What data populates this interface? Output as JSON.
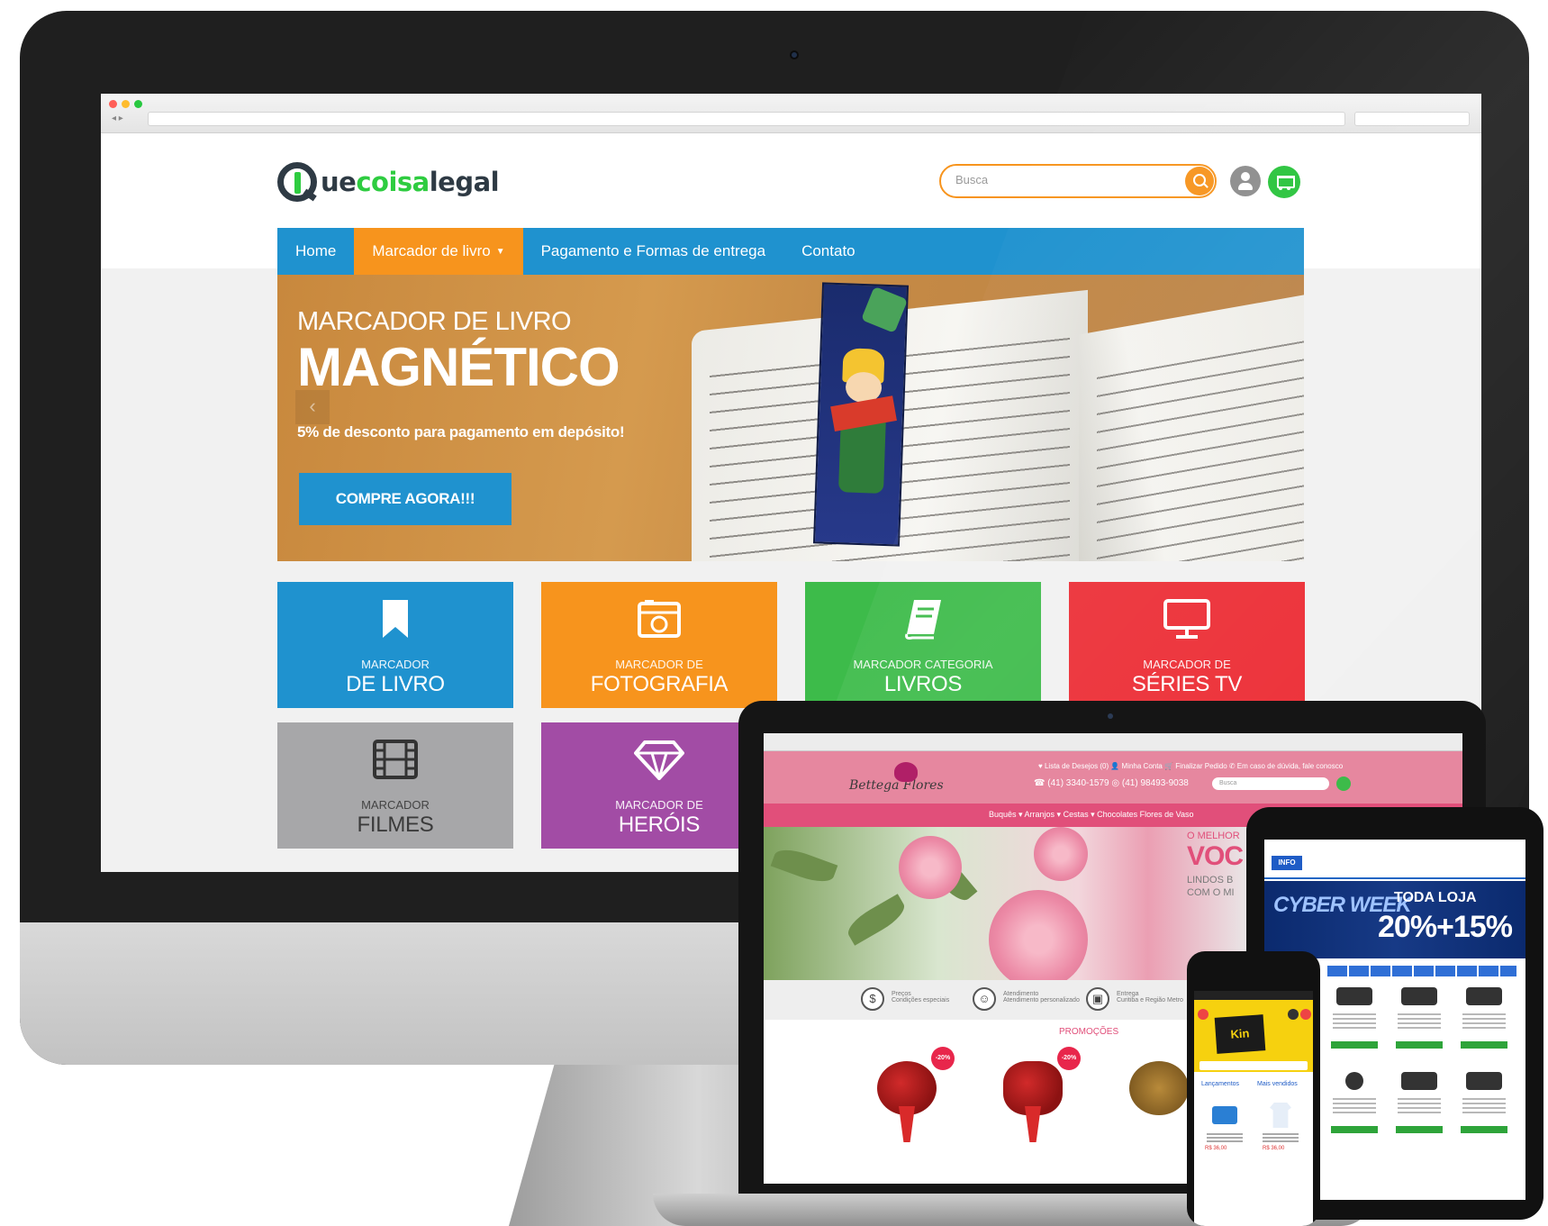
{
  "site": {
    "logo": {
      "prefix": "Q",
      "part1": "ue",
      "part2": "coisa",
      "part3": "legal"
    },
    "search": {
      "placeholder": "Busca"
    },
    "nav": {
      "items": [
        {
          "label": "Home"
        },
        {
          "label": "Marcador de livro",
          "dropdown": true
        },
        {
          "label": "Pagamento e Formas de entrega"
        },
        {
          "label": "Contato"
        }
      ],
      "active_index": 1
    },
    "hero": {
      "subtitle": "MARCADOR DE LIVRO",
      "title": "MAGNÉTICO",
      "description": "5% de desconto para pagamento em depósito!",
      "cta": "COMPRE AGORA!!!",
      "prev": "‹"
    },
    "categories": [
      {
        "small": "MARCADOR",
        "large": "DE LIVRO",
        "color": "#1f92cf",
        "icon": "bookmark-icon"
      },
      {
        "small": "MARCADOR DE",
        "large": "FOTOGRAFIA",
        "color": "#f7941d",
        "icon": "camera-icon"
      },
      {
        "small": "MARCADOR CATEGORIA",
        "large": "LIVROS",
        "color": "#3dbb4a",
        "icon": "book-icon"
      },
      {
        "small": "MARCADOR DE",
        "large": "SÉRIES TV",
        "color": "#ec2d35",
        "icon": "monitor-icon"
      },
      {
        "small": "MARCADOR",
        "large": "FILMES",
        "color": "#a7a7a9",
        "icon": "film-icon"
      },
      {
        "small": "MARCADOR DE",
        "large": "HERÓIS",
        "color": "#a24ca5",
        "icon": "diamond-icon"
      }
    ],
    "colors": {
      "primary": "#1f92cf",
      "accent": "#f7941d",
      "green": "#27c33a"
    }
  },
  "laptop": {
    "logo": "Bettega Flores",
    "top_links": "♥ Lista de Desejos (0)   👤 Minha Conta   🛒 Finalizar Pedido   ✆ Em caso de dúvida, fale conosco",
    "phones": "☎ (41) 3340-1579   ◎ (41) 98493-9038",
    "search_placeholder": "Busca",
    "nav": "Buquês ▾     Arranjos ▾     Cestas ▾     Chocolates     Flores de Vaso",
    "hero": {
      "kicker": "O MELHOR",
      "big": "VOC",
      "line1": "LINDOS B",
      "line2": "COM O MI"
    },
    "features": [
      {
        "icon": "$",
        "title": "Preços",
        "text": "Condições especiais"
      },
      {
        "icon": "☺",
        "title": "Atendimento",
        "text": "Atendimento personalizado"
      },
      {
        "icon": "▣",
        "title": "Entrega",
        "text": "Curitiba e Região Metro"
      }
    ],
    "promo_title": "PROMOÇÕES",
    "badge": "-20%"
  },
  "tablet": {
    "logo": "INFO",
    "banner_left": "CYBER WEEK",
    "banner_top": "TODA LOJA",
    "banner_offer": "20%+15%"
  },
  "phone": {
    "logo": "Kin",
    "categories": [
      "Lançamentos",
      "Mais vendidos"
    ],
    "price": "R$ 36,00"
  }
}
